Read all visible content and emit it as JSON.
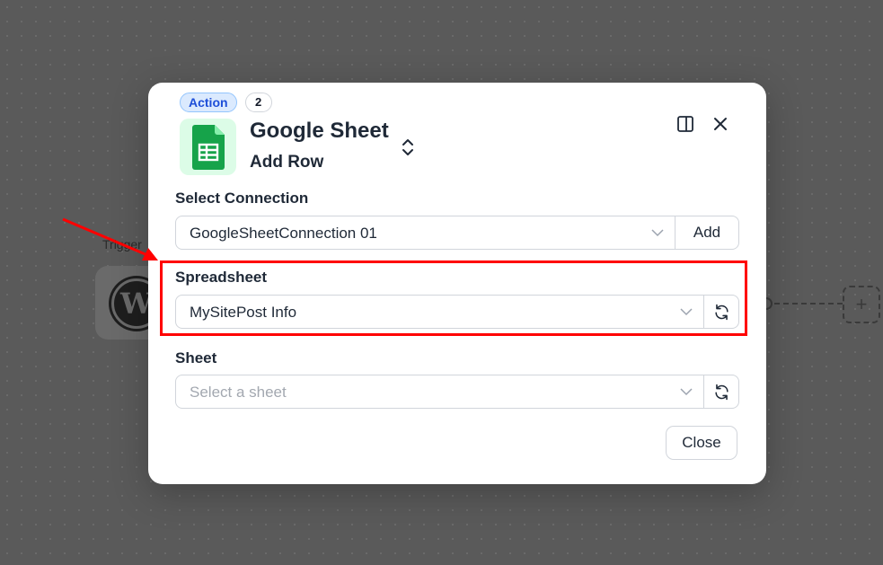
{
  "background": {
    "trigger_label": "Trigger"
  },
  "modal": {
    "badge_action": "Action",
    "badge_step": "2",
    "app_title": "Google Sheet",
    "app_subtitle": "Add Row",
    "connection": {
      "label": "Select Connection",
      "value": "GoogleSheetConnection 01",
      "add_label": "Add"
    },
    "spreadsheet": {
      "label": "Spreadsheet",
      "value": "MySitePost Info"
    },
    "sheet": {
      "label": "Sheet",
      "placeholder": "Select a sheet"
    },
    "close_label": "Close"
  },
  "colors": {
    "accent_blue": "#1d4ed8",
    "sheets_green": "#16a34a",
    "annotation_red": "#ff0000"
  },
  "icons": [
    "google-sheets-icon",
    "swap-icon",
    "panel-icon",
    "close-icon",
    "chevron-down-icon",
    "refresh-icon",
    "wordpress-icon",
    "plus-icon"
  ]
}
